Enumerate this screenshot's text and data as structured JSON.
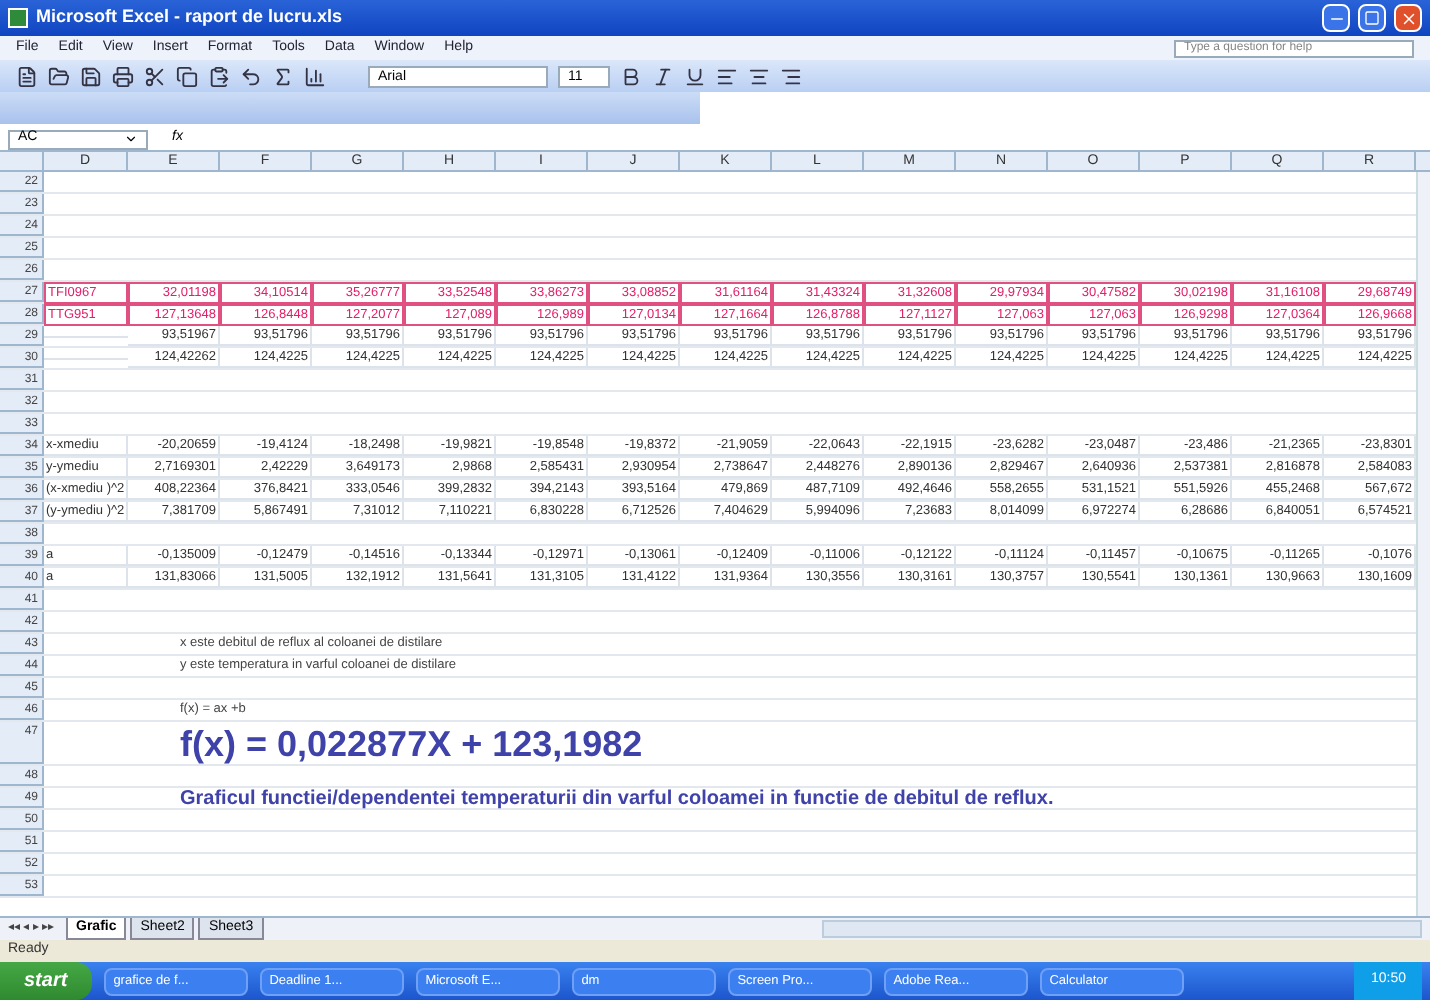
{
  "window": {
    "title": "Microsoft Excel - raport de lucru.xls"
  },
  "menu": [
    "File",
    "Edit",
    "View",
    "Insert",
    "Format",
    "Tools",
    "Data",
    "Window",
    "Help"
  ],
  "help_box": {
    "placeholder": "Type a question for help"
  },
  "font_box": {
    "value": "Arial"
  },
  "size_box": {
    "value": "11"
  },
  "name_box": {
    "value": "AC"
  },
  "formula_label": "fx",
  "tab_navigation": "◂◂ ◂ ▸ ▸▸",
  "columns": [
    "D",
    "E",
    "F",
    "G",
    "H",
    "I",
    "J",
    "K",
    "L",
    "M",
    "N",
    "O",
    "P",
    "Q",
    "R"
  ],
  "rows": [
    {
      "num": "22",
      "kind": "empty"
    },
    {
      "num": "23",
      "kind": "empty"
    },
    {
      "num": "24",
      "kind": "empty"
    },
    {
      "num": "25",
      "kind": "empty"
    },
    {
      "num": "26",
      "kind": "empty"
    },
    {
      "num": "27",
      "kind": "highlight",
      "label": "TFI0967",
      "cells": [
        "32,01198",
        "34,10514",
        "35,26777",
        "33,52548",
        "33,86273",
        "33,08852",
        "31,61164",
        "31,43324",
        "31,32608",
        "29,97934",
        "30,47582",
        "30,02198",
        "31,16108",
        "29,68749"
      ]
    },
    {
      "num": "28",
      "kind": "highlight",
      "label": "TTG951",
      "cells": [
        "127,13648",
        "126,8448",
        "127,2077",
        "127,089",
        "126,989",
        "127,0134",
        "127,1664",
        "126,8788",
        "127,1127",
        "127,063",
        "127,063",
        "126,9298",
        "127,0364",
        "126,9668"
      ]
    },
    {
      "num": "29",
      "kind": "values",
      "label": "",
      "cells": [
        "93,51967",
        "93,51796",
        "93,51796",
        "93,51796",
        "93,51796",
        "93,51796",
        "93,51796",
        "93,51796",
        "93,51796",
        "93,51796",
        "93,51796",
        "93,51796",
        "93,51796",
        "93,51796"
      ]
    },
    {
      "num": "30",
      "kind": "values",
      "label": "",
      "cells": [
        "124,42262",
        "124,4225",
        "124,4225",
        "124,4225",
        "124,4225",
        "124,4225",
        "124,4225",
        "124,4225",
        "124,4225",
        "124,4225",
        "124,4225",
        "124,4225",
        "124,4225",
        "124,4225"
      ]
    },
    {
      "num": "31",
      "kind": "empty"
    },
    {
      "num": "32",
      "kind": "empty"
    },
    {
      "num": "33",
      "kind": "empty"
    },
    {
      "num": "34",
      "kind": "values",
      "label": "x-xmediu",
      "cells": [
        "-20,20659",
        "-19,4124",
        "-18,2498",
        "-19,9821",
        "-19,8548",
        "-19,8372",
        "-21,9059",
        "-22,0643",
        "-22,1915",
        "-23,6282",
        "-23,0487",
        "-23,486",
        "-21,2365",
        "-23,8301"
      ]
    },
    {
      "num": "35",
      "kind": "values",
      "label": "y-ymediu",
      "cells": [
        "2,7169301",
        "2,42229",
        "3,649173",
        "2,9868",
        "2,585431",
        "2,930954",
        "2,738647",
        "2,448276",
        "2,890136",
        "2,829467",
        "2,640936",
        "2,537381",
        "2,816878",
        "2,584083"
      ]
    },
    {
      "num": "36",
      "kind": "values",
      "label": "(x-xmediu )^2",
      "cells": [
        "408,22364",
        "376,8421",
        "333,0546",
        "399,2832",
        "394,2143",
        "393,5164",
        "479,869",
        "487,7109",
        "492,4646",
        "558,2655",
        "531,1521",
        "551,5926",
        "455,2468",
        "567,672"
      ]
    },
    {
      "num": "37",
      "kind": "values",
      "label": "(y-ymediu )^2",
      "cells": [
        "7,381709",
        "5,867491",
        "7,31012",
        "7,110221",
        "6,830228",
        "6,712526",
        "7,404629",
        "5,994096",
        "7,23683",
        "8,014099",
        "6,972274",
        "6,28686",
        "6,840051",
        "6,574521"
      ]
    },
    {
      "num": "38",
      "kind": "empty"
    },
    {
      "num": "39",
      "kind": "values",
      "label": "a",
      "cells": [
        "-0,135009",
        "-0,12479",
        "-0,14516",
        "-0,13344",
        "-0,12971",
        "-0,13061",
        "-0,12409",
        "-0,11006",
        "-0,12122",
        "-0,11124",
        "-0,11457",
        "-0,10675",
        "-0,11265",
        "-0,1076"
      ]
    },
    {
      "num": "40",
      "kind": "values",
      "label": "a",
      "cells": [
        "131,83066",
        "131,5005",
        "132,1912",
        "131,5641",
        "131,3105",
        "131,4122",
        "131,9364",
        "130,3556",
        "130,3161",
        "130,3757",
        "130,5541",
        "130,1361",
        "130,9663",
        "130,1609"
      ]
    },
    {
      "num": "41",
      "kind": "empty"
    },
    {
      "num": "42",
      "kind": "empty"
    },
    {
      "num": "43",
      "kind": "note",
      "text": "x este debitul de reflux al coloanei de distilare"
    },
    {
      "num": "44",
      "kind": "note",
      "text": "y este temperatura in varful coloanei de distilare"
    },
    {
      "num": "45",
      "kind": "empty"
    },
    {
      "num": "46",
      "kind": "note",
      "text": "f(x) = ax +b"
    },
    {
      "num": "47",
      "kind": "formula",
      "text": "f(x) = 0,022877X + 123,1982"
    },
    {
      "num": "48",
      "kind": "empty"
    },
    {
      "num": "49",
      "kind": "caption",
      "text": "Graficul functiei/dependentei temperaturii din varful coloamei in functie de debitul de reflux."
    },
    {
      "num": "50",
      "kind": "empty"
    },
    {
      "num": "51",
      "kind": "empty"
    },
    {
      "num": "52",
      "kind": "empty"
    },
    {
      "num": "53",
      "kind": "empty"
    }
  ],
  "sheet_tabs": [
    {
      "label": "Grafic",
      "selected": true
    },
    {
      "label": "Sheet2",
      "selected": false
    },
    {
      "label": "Sheet3",
      "selected": false
    }
  ],
  "status_bar": "Ready",
  "taskbar": {
    "start": "start",
    "items": [
      "grafice de f...",
      "Deadline 1...",
      "Microsoft E...",
      "dm",
      "Screen Pro...",
      "Adobe Rea...",
      "Calculator"
    ],
    "clock": "10:50"
  }
}
